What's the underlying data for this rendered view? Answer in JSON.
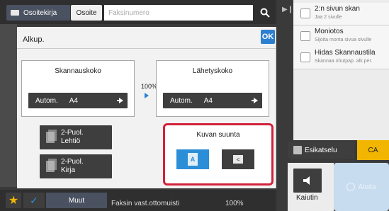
{
  "top": {
    "addressbook_label": "Osoitekirja",
    "address_label": "Osoite",
    "fax_placeholder": "Faksinumero"
  },
  "panel": {
    "title": "Alkup.",
    "ok_label": "OK",
    "scan_size": {
      "title": "Skannauskoko",
      "mode": "Autom.",
      "size": "A4"
    },
    "ratio": "100%",
    "send_size": {
      "title": "Lähetyskoko",
      "mode": "Autom.",
      "size": "A4"
    },
    "duplex_tablet": "2-Puol.\nLehtiö",
    "duplex_book": "2-Puol.\nKirja",
    "orientation": {
      "title": "Kuvan suunta",
      "portrait_glyph": "A",
      "landscape_glyph": "<"
    }
  },
  "bottom": {
    "muut_label": "Muut",
    "status": "Faksin vast.ottomuisti",
    "status_pct": "100%"
  },
  "right": {
    "items": [
      {
        "title": "2:n sivun skan",
        "sub": "Jaa 2 sivulle"
      },
      {
        "title": "Moniotos",
        "sub": "Sijoita monta sivua sivulle"
      },
      {
        "title": "Hidas Skannaustila",
        "sub": "Skannaa ohutpap. alk.per."
      }
    ],
    "preview_label": "Esikatselu",
    "ca_label": "CA",
    "speaker_label": "Kaiutin",
    "start_label": "Aloita"
  },
  "colors": {
    "accent_blue": "#2d7fd0",
    "highlight_red": "#d3213b",
    "ca_yellow": "#f2b600"
  }
}
